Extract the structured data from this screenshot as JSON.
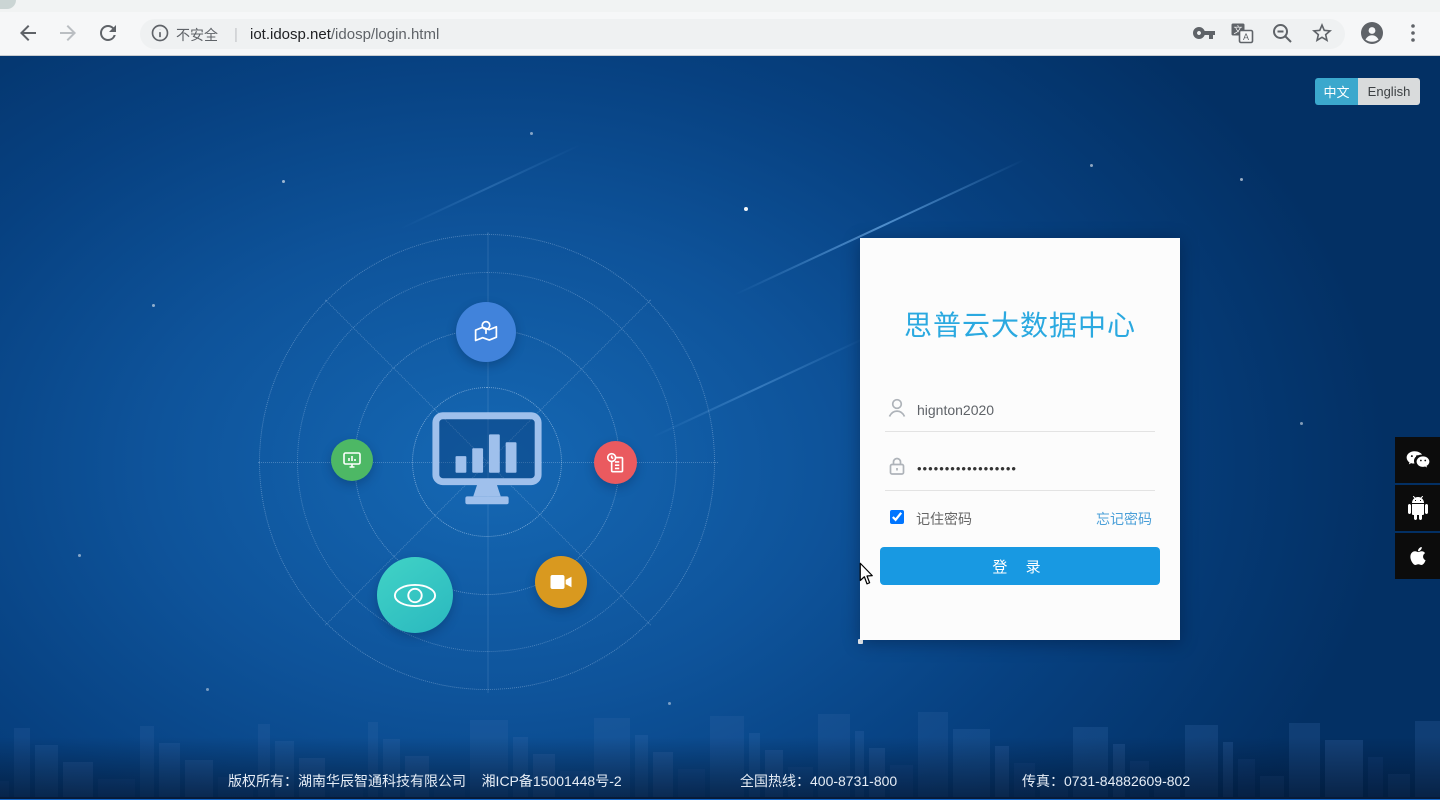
{
  "browser": {
    "security_label": "不安全",
    "separator": "|",
    "url_domain": "iot.idosp.net",
    "url_path": "/idosp/login.html"
  },
  "language": {
    "chinese": "中文",
    "english": "English"
  },
  "login": {
    "title": "思普云大数据中心",
    "username_value": "hignton2020",
    "password_masked": "••••••••••••••••••",
    "remember_label": "记住密码",
    "remember_checked": true,
    "forgot_label": "忘记密码",
    "submit_label": "登 录"
  },
  "footer": {
    "copyright_label": "版权所有：湖南华辰智通科技有限公司",
    "icp_label": "湘ICP备15001448号-2",
    "hotline_label": "全国热线：400-8731-800",
    "fax_label": "传真：0731-84882609-802"
  },
  "hub_icons": [
    "map-pin",
    "dashboard-monitor",
    "small-monitor",
    "report-clock",
    "eye",
    "video-camera"
  ],
  "social_icons": [
    "wechat",
    "android",
    "apple"
  ],
  "colors": {
    "title_blue": "#2BA9E0",
    "button_blue": "#1899E2",
    "link_blue": "#4A9FD8",
    "lang_active_bg": "#3BA8CD",
    "bg_center": "#1568B4",
    "bg_edge": "#033064",
    "bottom_bar": "#1668C9",
    "sat_blue": "#4183DB",
    "sat_green": "#4DB865",
    "sat_red": "#EA5A5F",
    "sat_teal": "#36C8C0",
    "sat_orange": "#D9991F"
  }
}
